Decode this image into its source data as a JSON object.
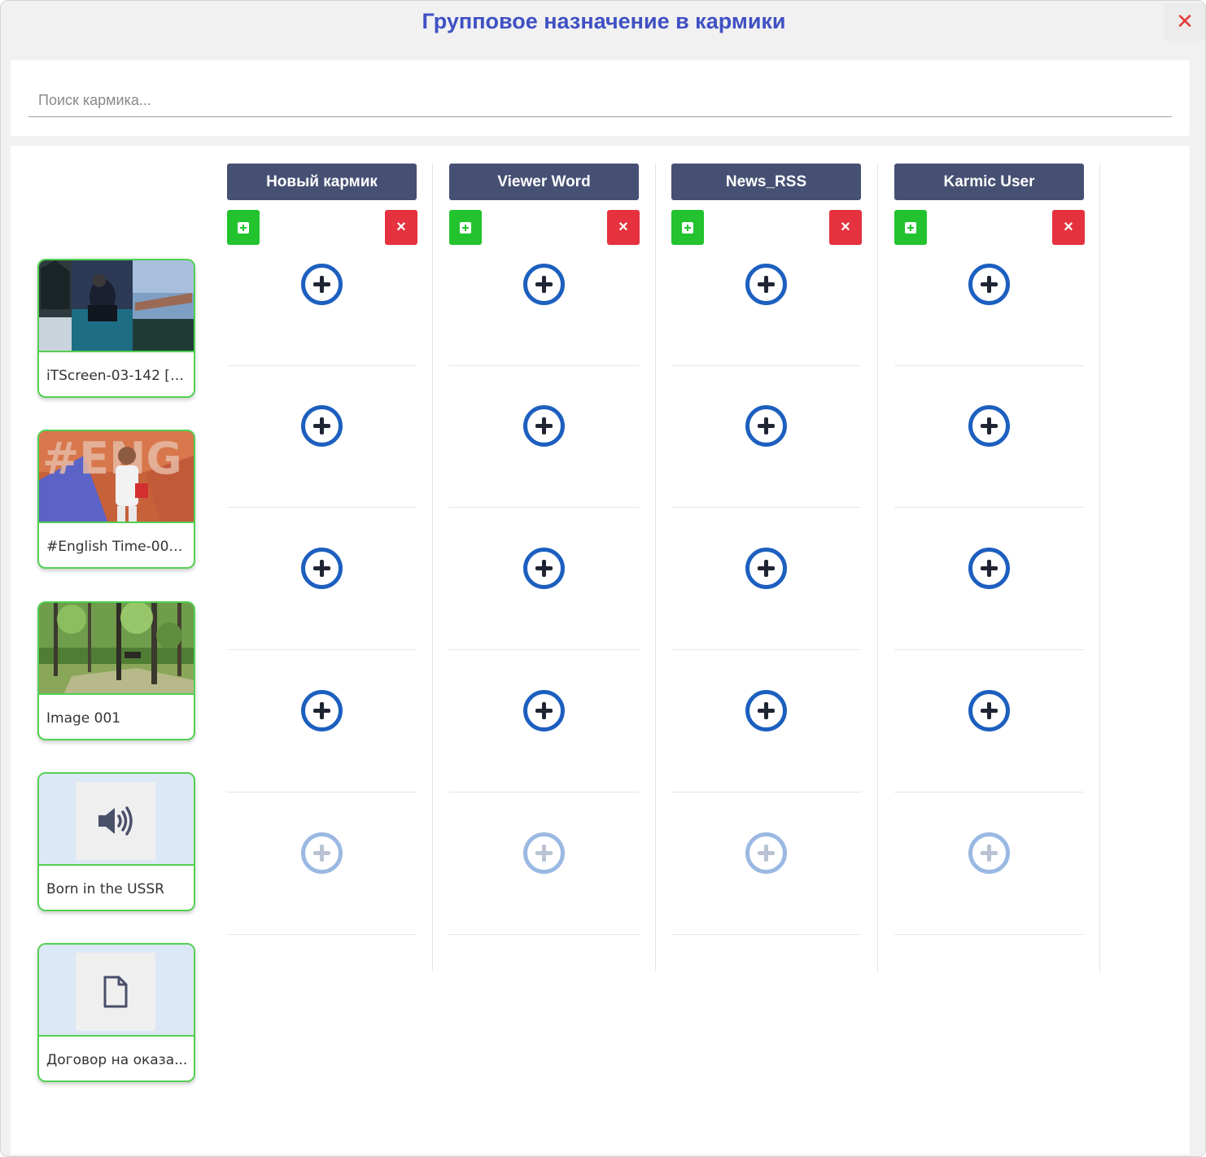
{
  "dialog": {
    "title": "Групповое назначение в кармики",
    "close_symbol": "✕"
  },
  "search": {
    "placeholder": "Поиск кармика..."
  },
  "media": [
    {
      "name": "iTScreen-03-142 [A...",
      "type": "image",
      "icon": "collage-thumbnail"
    },
    {
      "name": "#English Time-004 ...",
      "type": "image",
      "icon": "english-time-thumbnail"
    },
    {
      "name": "Image 001",
      "type": "image",
      "icon": "forest-thumbnail"
    },
    {
      "name": "Born in the USSR",
      "type": "audio",
      "icon": "speaker-icon"
    },
    {
      "name": "Договор на оказа...",
      "type": "document",
      "icon": "document-icon"
    }
  ],
  "karmics": [
    {
      "name": "Новый кармик"
    },
    {
      "name": "Viewer Word"
    },
    {
      "name": "News_RSS"
    },
    {
      "name": "Karmic User"
    }
  ],
  "cell_states": [
    "active",
    "active",
    "active",
    "active",
    "disabled"
  ],
  "colors": {
    "title": "#3f51c4",
    "header_bg": "#465073",
    "add_green": "#22c32e",
    "remove_red": "#e5323e",
    "add_circle": "#1c5fbf",
    "media_border": "#52d052"
  }
}
